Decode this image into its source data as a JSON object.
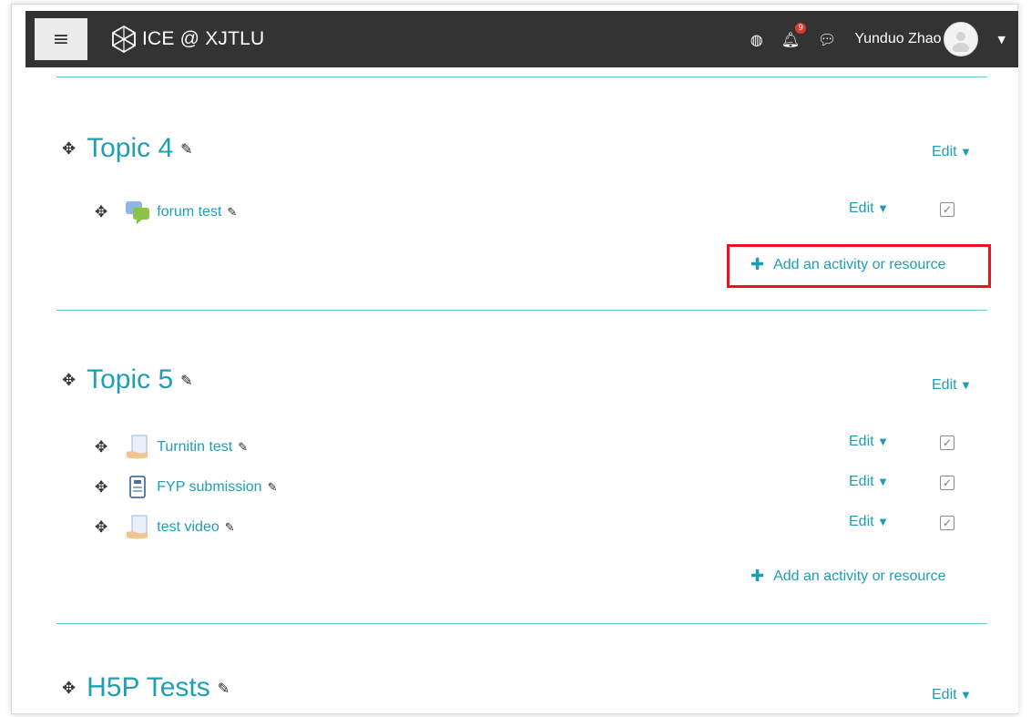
{
  "navbar": {
    "menu_icon": "hamburger-icon",
    "brand": "ICE @ XJTLU",
    "username": "Yunduo Zhao",
    "notification_count": "9",
    "colors": {
      "bg": "#333333",
      "accent": "#1f9eb6"
    }
  },
  "sections": [
    {
      "title": "Topic 4",
      "edit_label": "Edit",
      "activities": [
        {
          "name": "forum test",
          "icon": "forum-icon",
          "edit_label": "Edit"
        }
      ],
      "add_label": "Add an activity or resource"
    },
    {
      "title": "Topic 5",
      "edit_label": "Edit",
      "activities": [
        {
          "name": "Turnitin test",
          "icon": "turnitin-icon",
          "edit_label": "Edit"
        },
        {
          "name": "FYP submission",
          "icon": "assignment-icon",
          "edit_label": "Edit"
        },
        {
          "name": "test video",
          "icon": "turnitin-icon",
          "edit_label": "Edit"
        }
      ],
      "add_label": "Add an activity or resource"
    },
    {
      "title": "H5P Tests",
      "edit_label": "Edit"
    }
  ],
  "highlight_color": "#e8141b"
}
